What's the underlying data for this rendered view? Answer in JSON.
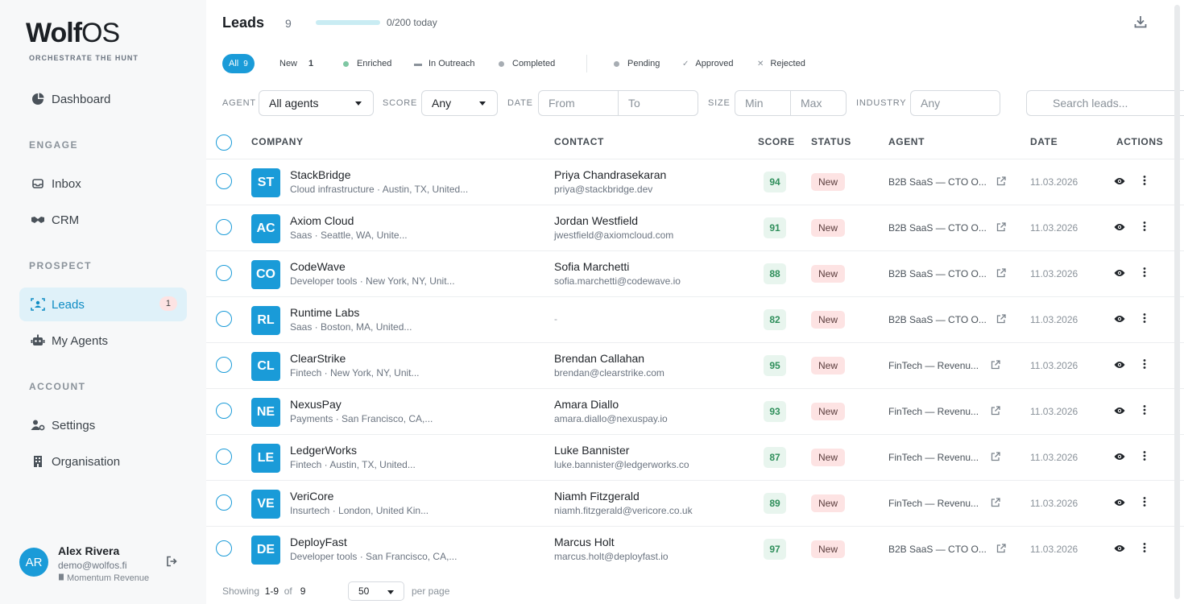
{
  "brand": {
    "name_a": "Wolf",
    "name_b": "OS",
    "tagline": "ORCHESTRATE THE HUNT"
  },
  "sidebar": {
    "dashboard": "Dashboard",
    "engage_label": "ENGAGE",
    "inbox": "Inbox",
    "crm": "CRM",
    "prospect_label": "PROSPECT",
    "leads": "Leads",
    "leads_badge": "1",
    "my_agents": "My Agents",
    "account_label": "ACCOUNT",
    "settings": "Settings",
    "organisation": "Organisation"
  },
  "user": {
    "initials": "AR",
    "name": "Alex Rivera",
    "email": "demo@wolfos.fi",
    "org": "Momentum Revenue"
  },
  "header": {
    "title": "Leads",
    "count": "9",
    "progress_text": "0/200 today",
    "progress_fraction": 0.0
  },
  "tabs": {
    "all": "All",
    "all_count": "9",
    "new": "New",
    "new_count": "1",
    "enriched": "Enriched",
    "in_outreach": "In Outreach",
    "completed": "Completed",
    "pending": "Pending",
    "approved": "Approved",
    "rejected": "Rejected"
  },
  "filters": {
    "agent_label": "AGENT",
    "agent_value": "All agents",
    "score_label": "SCORE",
    "score_value": "Any",
    "date_label": "DATE",
    "date_from": "From",
    "date_to": "To",
    "size_label": "SIZE",
    "size_min": "Min",
    "size_max": "Max",
    "industry_label": "INDUSTRY",
    "industry_value": "Any",
    "search_placeholder": "Search leads..."
  },
  "table": {
    "headers": {
      "company": "COMPANY",
      "contact": "CONTACT",
      "score": "SCORE",
      "status": "STATUS",
      "agent": "AGENT",
      "date": "DATE",
      "actions": "ACTIONS"
    },
    "rows": [
      {
        "initials": "ST",
        "company": "StackBridge",
        "meta": "Cloud infrastructure · Austin, TX, United...",
        "contact": "Priya Chandrasekaran",
        "email": "priya@stackbridge.dev",
        "score": "94",
        "status": "New",
        "agent": "B2B SaaS — CTO O...",
        "date": "11.03.2026"
      },
      {
        "initials": "AC",
        "company": "Axiom Cloud",
        "meta": "Saas · Seattle, WA, Unite...",
        "contact": "Jordan Westfield",
        "email": "jwestfield@axiomcloud.com",
        "score": "91",
        "status": "New",
        "agent": "B2B SaaS — CTO O...",
        "date": "11.03.2026"
      },
      {
        "initials": "CO",
        "company": "CodeWave",
        "meta": "Developer tools · New York, NY, Unit...",
        "contact": "Sofia Marchetti",
        "email": "sofia.marchetti@codewave.io",
        "score": "88",
        "status": "New",
        "agent": "B2B SaaS — CTO O...",
        "date": "11.03.2026"
      },
      {
        "initials": "RL",
        "company": "Runtime Labs",
        "meta": "Saas · Boston, MA, United...",
        "contact": "",
        "email": "",
        "dash": "-",
        "score": "82",
        "status": "New",
        "agent": "B2B SaaS — CTO O...",
        "date": "11.03.2026"
      },
      {
        "initials": "CL",
        "company": "ClearStrike",
        "meta": "Fintech · New York, NY, Unit...",
        "contact": "Brendan Callahan",
        "email": "brendan@clearstrike.com",
        "score": "95",
        "status": "New",
        "agent": "FinTech — Revenu...",
        "date": "11.03.2026"
      },
      {
        "initials": "NE",
        "company": "NexusPay",
        "meta": "Payments · San Francisco, CA,...",
        "contact": "Amara Diallo",
        "email": "amara.diallo@nexuspay.io",
        "score": "93",
        "status": "New",
        "agent": "FinTech — Revenu...",
        "date": "11.03.2026"
      },
      {
        "initials": "LE",
        "company": "LedgerWorks",
        "meta": "Fintech · Austin, TX, United...",
        "contact": "Luke Bannister",
        "email": "luke.bannister@ledgerworks.co",
        "score": "87",
        "status": "New",
        "agent": "FinTech — Revenu...",
        "date": "11.03.2026"
      },
      {
        "initials": "VE",
        "company": "VeriCore",
        "meta": "Insurtech · London, United Kin...",
        "contact": "Niamh Fitzgerald",
        "email": "niamh.fitzgerald@vericore.co.uk",
        "score": "89",
        "status": "New",
        "agent": "FinTech — Revenu...",
        "date": "11.03.2026"
      },
      {
        "initials": "DE",
        "company": "DeployFast",
        "meta": "Developer tools · San Francisco, CA,...",
        "contact": "Marcus Holt",
        "email": "marcus.holt@deployfast.io",
        "score": "97",
        "status": "New",
        "agent": "B2B SaaS — CTO O...",
        "date": "11.03.2026"
      }
    ]
  },
  "footer": {
    "showing": "Showing",
    "range": "1-9",
    "of": "of",
    "total": "9",
    "per_page_value": "50",
    "per_page": "per page"
  },
  "colors": {
    "accent": "#1a9bd8",
    "score_bg": "#e8f5ee",
    "status_new_bg": "#fde3e3"
  }
}
